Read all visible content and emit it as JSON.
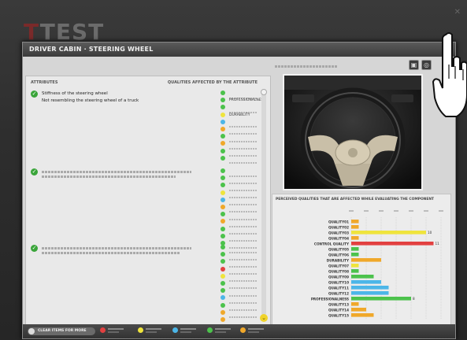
{
  "background_app": {
    "logo_prefix": "T",
    "logo_text": "TEST",
    "subtitle": "",
    "close_label": "✕"
  },
  "modal": {
    "title": "DRIVER CABIN · STEERING WHEEL",
    "left_panel": {
      "attributes_header": "ATTRIBUTES",
      "qualities_header": "QUALITIES AFFECTED BY THE ATTRIBUTE",
      "attributes": [
        {
          "line1": "Stiffness of the steering wheel",
          "line2": "Not resembling the steering wheel of a truck",
          "qualities": [
            "PROFESSIONALNESS",
            "DURABILITY"
          ],
          "dots": [
            "g",
            "g",
            "g",
            "y",
            "b",
            "o",
            "g",
            "o",
            "g",
            "g"
          ]
        },
        {
          "line1": "",
          "line2": "",
          "qualities": [],
          "dots": [
            "g",
            "g",
            "g",
            "y",
            "b",
            "o",
            "g",
            "o",
            "g",
            "g",
            "g"
          ]
        },
        {
          "line1": "",
          "line2": "",
          "qualities": [],
          "dots": [
            "g",
            "g",
            "g",
            "r",
            "y",
            "g",
            "g",
            "b",
            "g",
            "o",
            "o",
            "g"
          ]
        }
      ],
      "scroll_down_label": "⌄"
    },
    "footer": {
      "clear_button_label": "CLEAR ITEMS FOR MORE",
      "legend": [
        {
          "color": "#e24040"
        },
        {
          "color": "#efe43c"
        },
        {
          "color": "#4cb6e8"
        },
        {
          "color": "#4cc24c"
        },
        {
          "color": "#f0a82a"
        }
      ]
    },
    "toolbar": {
      "buttons": [
        {
          "icon": "car-front-icon",
          "glyph": "▣"
        },
        {
          "icon": "steering-wheel-icon",
          "glyph": "◎"
        }
      ]
    },
    "chart_panel": {
      "title": "PERCEIVED QUALITIES THAT ARE AFFECTED WHILE EVALUATING THE COMPONENT"
    }
  },
  "chart_data": {
    "type": "bar",
    "orientation": "horizontal",
    "title": "PERCEIVED QUALITIES THAT ARE AFFECTED WHILE EVALUATING THE COMPONENT",
    "categories": [
      "QUALITY01",
      "QUALITY02",
      "QUALITY03",
      "QUALITY04",
      "CONTROL QUALITY",
      "QUALITY05",
      "QUALITY06",
      "DURABILITY",
      "QUALITY07",
      "QUALITY08",
      "QUALITY09",
      "QUALITY10",
      "QUALITY11",
      "QUALITY12",
      "PROFESSIONALNESS",
      "QUALITY13",
      "QUALITY14",
      "QUALITY15"
    ],
    "values": [
      1,
      1,
      10,
      1,
      11,
      1,
      1,
      4,
      1,
      1,
      3,
      4,
      5,
      5,
      8,
      1,
      2,
      3
    ],
    "colors": [
      "#f0a82a",
      "#f0a82a",
      "#efe43c",
      "#f0a82a",
      "#e24040",
      "#4cc24c",
      "#4cc24c",
      "#f0a82a",
      "#efe43c",
      "#4cc24c",
      "#4cc24c",
      "#4cb6e8",
      "#4cb6e8",
      "#4cb6e8",
      "#4cc24c",
      "#f0a82a",
      "#f0a82a",
      "#f0a82a"
    ],
    "labels_visible": [
      "",
      "",
      "10",
      "",
      "11",
      "",
      "",
      "",
      "",
      "",
      "",
      "",
      "",
      "",
      "8",
      "",
      "",
      ""
    ],
    "xlim": [
      0,
      12
    ],
    "grid": true
  },
  "cursor": {
    "icon": "hand-pointer-icon"
  }
}
